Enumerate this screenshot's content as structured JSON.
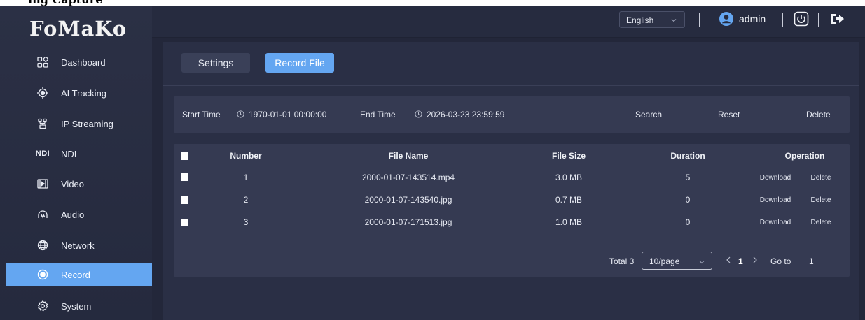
{
  "caption": "ing Capture",
  "sidebar": {
    "logo": "FoMaKo",
    "items": [
      {
        "label": "Dashboard",
        "icon": "dashboard-icon"
      },
      {
        "label": "AI Tracking",
        "icon": "target-icon"
      },
      {
        "label": "IP Streaming",
        "icon": "streaming-icon"
      },
      {
        "label": "NDI",
        "icon": "ndi-icon",
        "mark": "NDI"
      },
      {
        "label": "Video",
        "icon": "video-icon"
      },
      {
        "label": "Audio",
        "icon": "audio-icon"
      },
      {
        "label": "Network",
        "icon": "globe-icon"
      },
      {
        "label": "Record",
        "icon": "record-icon",
        "active": true
      },
      {
        "label": "System",
        "icon": "gear-icon"
      }
    ]
  },
  "header": {
    "language": "English",
    "user": "admin"
  },
  "tabs": {
    "settings": "Settings",
    "record_file": "Record File",
    "active": "record_file"
  },
  "filter": {
    "start_label": "Start Time",
    "start_value": "1970-01-01 00:00:00",
    "end_label": "End Time",
    "end_value": "2026-03-23 23:59:59",
    "search": "Search",
    "reset": "Reset",
    "delete": "Delete"
  },
  "table": {
    "columns": {
      "number": "Number",
      "file_name": "File Name",
      "file_size": "File Size",
      "duration": "Duration",
      "operation": "Operation"
    },
    "rows": [
      {
        "number": "1",
        "file_name": "2000-01-07-143514.mp4",
        "file_size": "3.0 MB",
        "duration": "5",
        "download": "Download",
        "delete": "Delete"
      },
      {
        "number": "2",
        "file_name": "2000-01-07-143540.jpg",
        "file_size": "0.7 MB",
        "duration": "0",
        "download": "Download",
        "delete": "Delete"
      },
      {
        "number": "3",
        "file_name": "2000-01-07-171513.jpg",
        "file_size": "1.0 MB",
        "duration": "0",
        "download": "Download",
        "delete": "Delete"
      }
    ]
  },
  "pagination": {
    "total": "Total 3",
    "page_size": "10/page",
    "current_page": "1",
    "goto_label": "Go to",
    "goto_value": "1"
  },
  "colors": {
    "accent": "#64a6f1",
    "background": "#23273a",
    "panel": "#353a52"
  }
}
